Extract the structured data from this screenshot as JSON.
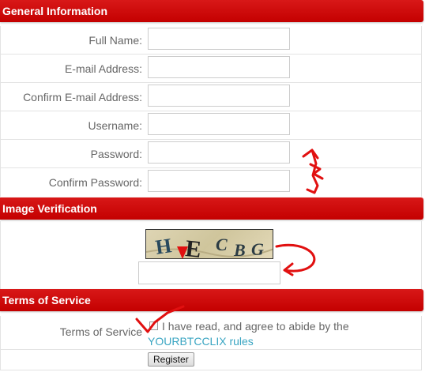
{
  "sections": {
    "general": "General Information",
    "verification": "Image Verification",
    "terms": "Terms of Service"
  },
  "fields": {
    "full_name": "Full Name:",
    "email": "E-mail Address:",
    "confirm_email": "Confirm E-mail Address:",
    "username": "Username:",
    "password": "Password:",
    "confirm_password": "Confirm Password:"
  },
  "captcha": {
    "letters": [
      "H",
      "E",
      "C",
      "B",
      "G"
    ]
  },
  "tos": {
    "label": "Terms of Service",
    "agree_text": "I have read, and agree to abide by the",
    "link_text": "YOURBTCCLIX rules"
  },
  "buttons": {
    "register": "Register"
  },
  "colors": {
    "header_red": "#d10a0a",
    "annotation_red": "#e11010",
    "link": "#3aa5c2"
  }
}
